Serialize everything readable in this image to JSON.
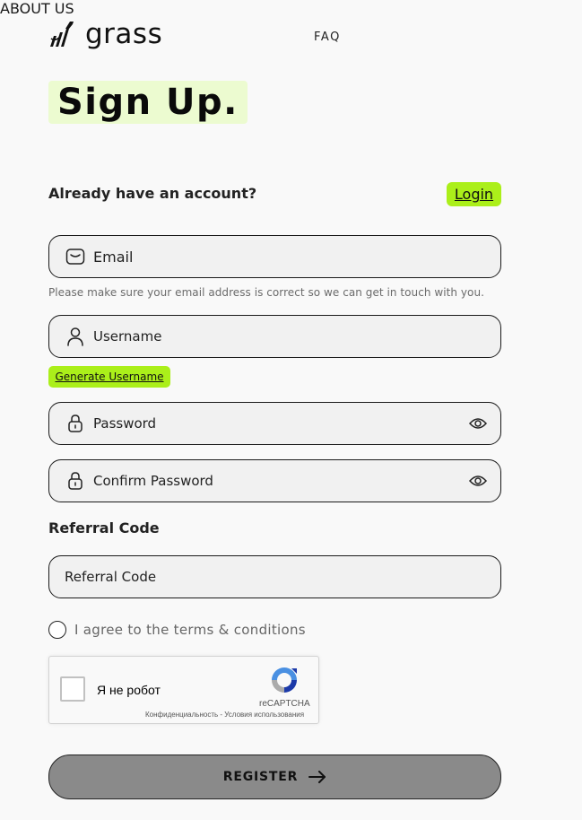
{
  "header": {
    "brand": "grass",
    "nav": [
      "ABOUT US",
      "FAQ"
    ]
  },
  "title": "Sign Up.",
  "account": {
    "prompt": "Already have an account?",
    "login_label": "Login"
  },
  "form": {
    "email_placeholder": "Email",
    "email_hint": "Please make sure your email address is correct so we can get in touch with you.",
    "username_placeholder": "Username",
    "generate_username_label": "Generate Username",
    "password_placeholder": "Password",
    "confirm_password_placeholder": "Confirm Password",
    "referral_label": "Referral Code",
    "referral_placeholder": "Referral Code",
    "agree_label": "I agree to the terms & conditions",
    "register_label": "REGISTER"
  },
  "captcha": {
    "label": "Я не робот",
    "brand": "reCAPTCHA",
    "links": "Конфиденциальность - Условия использования"
  },
  "colors": {
    "accent": "#abef1a",
    "title_highlight": "#ecfbd0",
    "background": "#f9f9f9",
    "register_bg": "#8a8a8a"
  }
}
